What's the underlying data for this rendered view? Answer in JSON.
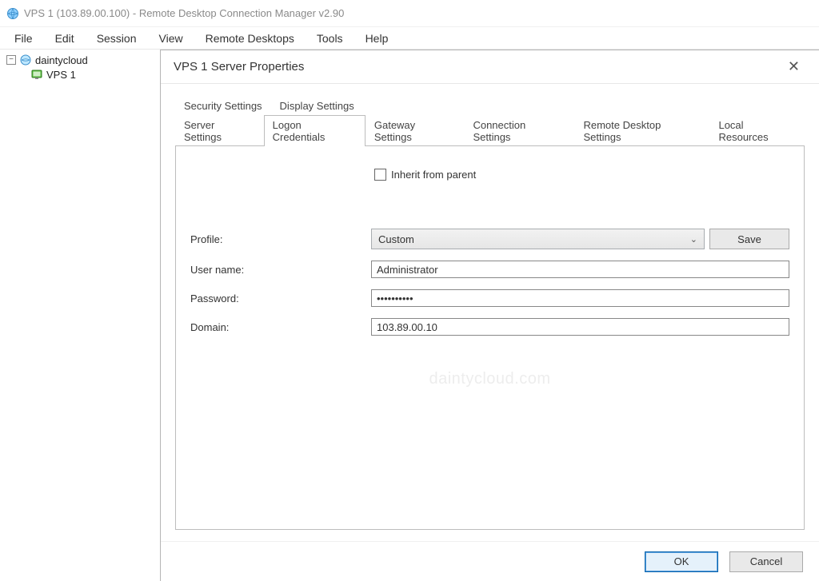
{
  "window": {
    "title": "VPS 1 (103.89.00.100) - Remote Desktop Connection Manager v2.90"
  },
  "menu": {
    "items": [
      "File",
      "Edit",
      "Session",
      "View",
      "Remote Desktops",
      "Tools",
      "Help"
    ]
  },
  "tree": {
    "root": {
      "label": "daintycloud",
      "expanded": "−"
    },
    "child": {
      "label": "VPS 1"
    }
  },
  "dialog": {
    "title": "VPS 1 Server Properties",
    "tabs_row1": [
      "Security Settings",
      "Display Settings"
    ],
    "tabs_row2": [
      "Server Settings",
      "Logon Credentials",
      "Gateway Settings",
      "Connection Settings",
      "Remote Desktop Settings",
      "Local Resources"
    ],
    "active_tab": "Logon Credentials",
    "inherit_label": "Inherit from parent",
    "profile_label": "Profile:",
    "profile_value": "Custom",
    "save_label": "Save",
    "username_label": "User name:",
    "username_value": "Administrator",
    "password_label": "Password:",
    "password_value": "••••••••••",
    "domain_label": "Domain:",
    "domain_value": "103.89.00.10",
    "watermark": "daintycloud.com",
    "ok_label": "OK",
    "cancel_label": "Cancel"
  }
}
